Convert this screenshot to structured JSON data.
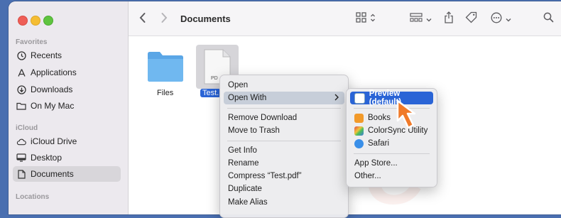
{
  "window": {
    "title": "Documents"
  },
  "sidebar": {
    "sections": [
      {
        "label": "Favorites",
        "items": [
          {
            "label": "Recents",
            "icon": "clock-icon"
          },
          {
            "label": "Applications",
            "icon": "applications-icon"
          },
          {
            "label": "Downloads",
            "icon": "download-icon"
          },
          {
            "label": "On My Mac",
            "icon": "folder-icon"
          }
        ]
      },
      {
        "label": "iCloud",
        "items": [
          {
            "label": "iCloud Drive",
            "icon": "cloud-icon"
          },
          {
            "label": "Desktop",
            "icon": "desktop-icon"
          },
          {
            "label": "Documents",
            "icon": "document-icon",
            "selected": true
          }
        ]
      },
      {
        "label": "Locations",
        "items": []
      }
    ]
  },
  "files": [
    {
      "label": "Files",
      "kind": "folder"
    },
    {
      "label": "Test.",
      "kind": "pdf",
      "thumb_text": "PD",
      "selected": true
    }
  ],
  "context_menu": {
    "groups": [
      [
        "Open",
        "Open With"
      ],
      [
        "Remove Download",
        "Move to Trash"
      ],
      [
        "Get Info",
        "Rename",
        "Compress “Test.pdf”",
        "Duplicate",
        "Make Alias"
      ]
    ],
    "highlighted": "Open With"
  },
  "submenu": {
    "default": "Preview (default)",
    "apps": [
      "Books",
      "ColorSync Utility",
      "Safari"
    ],
    "extra": [
      "App Store...",
      "Other..."
    ]
  },
  "colors": {
    "selection_blue": "#2a64d6",
    "highlight_gray": "#c7ced9",
    "arrow_orange": "#f07a2a"
  }
}
